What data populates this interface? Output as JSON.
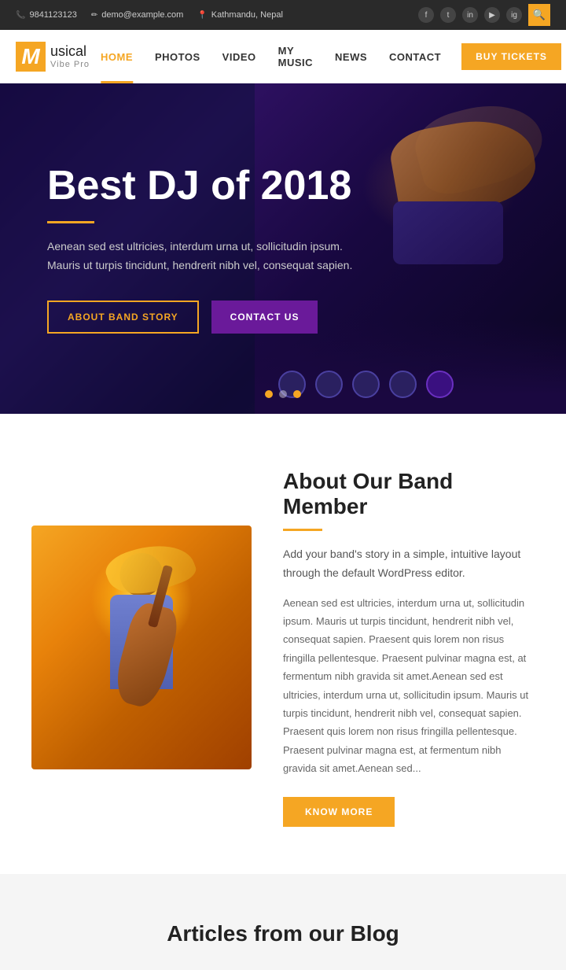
{
  "topbar": {
    "phone": "9841123123",
    "email": "demo@example.com",
    "location": "Kathmandu, Nepal",
    "phone_icon": "📞",
    "email_icon": "✉",
    "location_icon": "📍"
  },
  "social": {
    "facebook": "f",
    "twitter": "t",
    "linkedin": "in",
    "youtube": "▶",
    "instagram": "ig"
  },
  "navbar": {
    "logo_letter": "M",
    "logo_main": "usical",
    "logo_sub": "Vibe Pro",
    "links": [
      {
        "label": "HOME",
        "active": true
      },
      {
        "label": "PHOTOS",
        "active": false
      },
      {
        "label": "VIDEO",
        "active": false
      },
      {
        "label": "MY MUSIC",
        "active": false
      },
      {
        "label": "NEWS",
        "active": false
      },
      {
        "label": "CONTACT",
        "active": false
      }
    ],
    "buy_tickets": "BUY TICKETS"
  },
  "hero": {
    "title": "Best DJ of 2018",
    "subtitle_line1": "Aenean sed est ultricies, interdum urna ut, sollicitudin ipsum.",
    "subtitle_line2": "Mauris ut turpis tincidunt, hendrerit nibh vel, consequat sapien.",
    "btn1": "ABOUT BAND STORY",
    "btn2": "CONTACT US",
    "dots": [
      1,
      2,
      3
    ]
  },
  "about": {
    "title": "About Our Band Member",
    "intro": "Add your band's story in a simple, intuitive layout through the default WordPress editor.",
    "body": "Aenean sed est ultricies, interdum urna ut, sollicitudin ipsum. Mauris ut turpis tincidunt, hendrerit nibh vel, consequat sapien. Praesent quis lorem non risus fringilla pellentesque. Praesent pulvinar magna est, at fermentum nibh gravida sit amet.Aenean sed est ultricies, interdum urna ut, sollicitudin ipsum. Mauris ut turpis tincidunt, hendrerit nibh vel, consequat sapien. Praesent quis lorem non risus fringilla pellentesque. Praesent pulvinar magna est, at fermentum nibh gravida sit amet.Aenean sed...",
    "btn": "KNOW MORE"
  },
  "blog": {
    "title": "Articles from our Blog"
  }
}
